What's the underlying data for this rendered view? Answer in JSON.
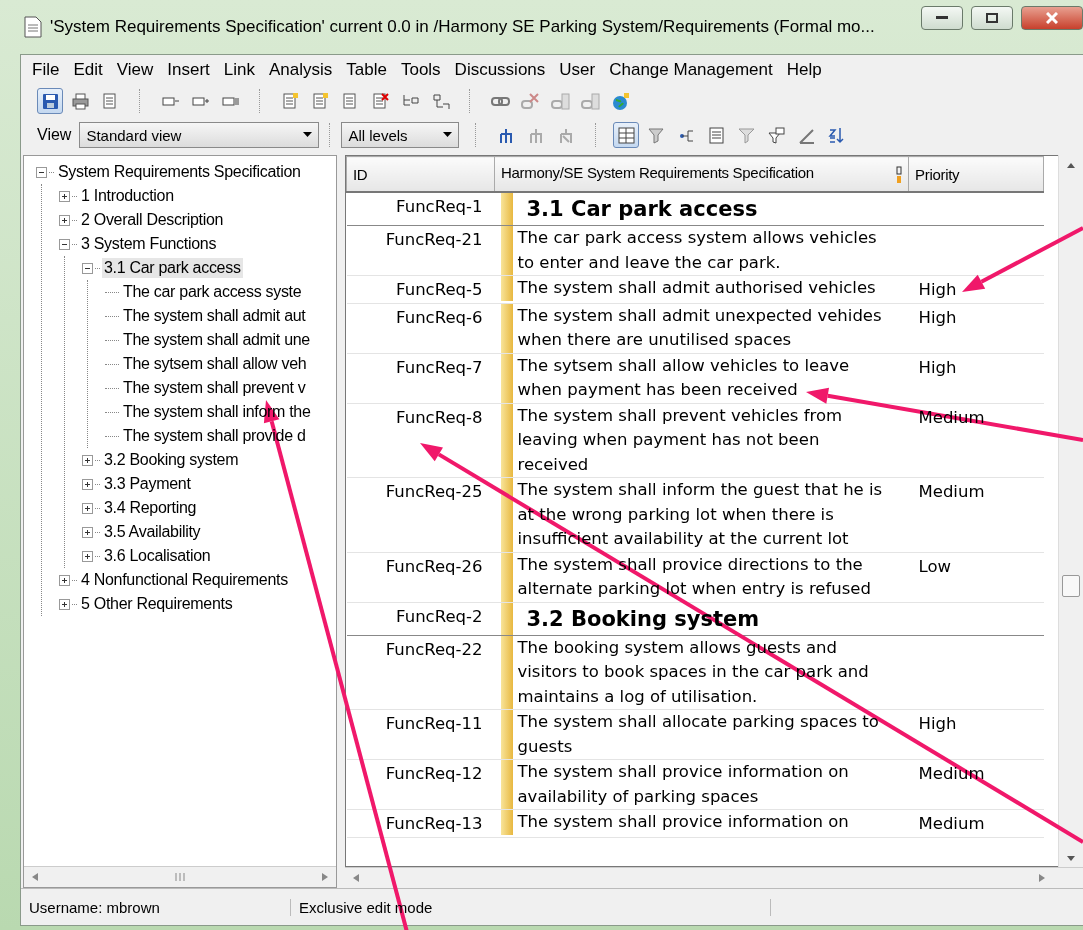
{
  "window": {
    "title": "'System Requirements Specification' current 0.0 in /Harmony SE   Parking System/Requirements (Formal mo..."
  },
  "menu": [
    "File",
    "Edit",
    "View",
    "Insert",
    "Link",
    "Analysis",
    "Table",
    "Tools",
    "Discussions",
    "User",
    "Change Management",
    "Help"
  ],
  "toolbar_1": [
    [
      {
        "selected": true
      },
      {
        "selected": false
      },
      {
        "selected": false
      }
    ],
    [
      {
        "selected": false
      },
      {
        "selected": false
      },
      {
        "selected": false
      }
    ],
    [
      {
        "selected": false
      },
      {
        "selected": false
      },
      {
        "selected": false
      },
      {
        "selected": false
      },
      {
        "selected": false
      },
      {
        "selected": false
      }
    ],
    [
      {
        "selected": false
      },
      {
        "selected": false
      },
      {
        "selected": false
      },
      {
        "selected": false
      },
      {
        "selected": false
      }
    ]
  ],
  "toolbar_2": {
    "view_label": "View",
    "view_select": "Standard view",
    "level_select": "All levels",
    "groups": [
      [
        {
          "selected": false
        },
        {
          "selected": false
        },
        {
          "selected": false
        }
      ],
      [
        {
          "selected": true
        },
        {
          "selected": false
        },
        {
          "selected": false
        },
        {
          "selected": false
        },
        {
          "selected": false
        },
        {
          "selected": false
        },
        {
          "selected": false
        },
        {
          "selected": false
        }
      ]
    ]
  },
  "tree": {
    "label": "System Requirements Specification",
    "expanded": true,
    "selected": false,
    "children": [
      {
        "label": "1 Introduction",
        "expanded": false,
        "selected": false
      },
      {
        "label": "2 Overall Description",
        "expanded": false,
        "selected": false
      },
      {
        "label": "3 System Functions",
        "expanded": true,
        "selected": false,
        "children": [
          {
            "label": "3.1 Car park access",
            "expanded": true,
            "selected": true,
            "children": [
              {
                "label": "The car park access syste",
                "selected": false
              },
              {
                "label": "The system shall admit aut",
                "selected": false
              },
              {
                "label": "The system shall admit une",
                "selected": false
              },
              {
                "label": "The sytsem shall allow veh",
                "selected": false
              },
              {
                "label": "The system shall prevent v",
                "selected": false
              },
              {
                "label": "The system shall inform the",
                "selected": false
              },
              {
                "label": "The system shall provide d",
                "selected": false
              }
            ]
          },
          {
            "label": "3.2 Booking system",
            "expanded": false,
            "selected": false
          },
          {
            "label": "3.3 Payment",
            "expanded": false,
            "selected": false
          },
          {
            "label": "3.4 Reporting",
            "expanded": false,
            "selected": false
          },
          {
            "label": "3.5 Availability",
            "expanded": false,
            "selected": false
          },
          {
            "label": "3.6 Localisation",
            "expanded": false,
            "selected": false
          }
        ]
      },
      {
        "label": "4 Nonfunctional Requirements",
        "expanded": false,
        "selected": false
      },
      {
        "label": "5 Other Requirements",
        "expanded": false,
        "selected": false
      }
    ]
  },
  "table": {
    "columns": [
      "ID",
      "Harmony/SE System Requirements Specification",
      "Priority"
    ],
    "rows": [
      {
        "kind": "heading",
        "id": "FuncReq-1",
        "text": "3.1 Car park access"
      },
      {
        "kind": "text",
        "id": "FuncReq-21",
        "text": "The car park access system allows vehicles to enter and leave the car park."
      },
      {
        "kind": "text",
        "id": "FuncReq-5",
        "text": "The system shall admit authorised vehicles",
        "priority": "High"
      },
      {
        "kind": "text",
        "id": "FuncReq-6",
        "text": "The system shall admit unexpected vehides when there are unutilised spaces",
        "priority": "High"
      },
      {
        "kind": "text",
        "id": "FuncReq-7",
        "text": "The sytsem shall allow vehicles to leave when payment has been received",
        "priority": "High"
      },
      {
        "kind": "text",
        "id": "FuncReq-8",
        "text": "The system shall prevent vehicles from leaving when payment has not been received",
        "priority": "Medium"
      },
      {
        "kind": "text",
        "id": "FuncReq-25",
        "text": "The system shall inform the guest that he is at the wrong parking lot when there is insufficient availability at the current lot",
        "priority": "Medium"
      },
      {
        "kind": "text",
        "id": "FuncReq-26",
        "text": "The system shall provice directions to the alternate parking lot when entry is refused",
        "priority": "Low"
      },
      {
        "kind": "heading",
        "id": "FuncReq-2",
        "text": "3.2 Booking system"
      },
      {
        "kind": "text",
        "id": "FuncReq-22",
        "text": "The booking system allows guests and visitors to book spaces in the car park and maintains a log of utilisation."
      },
      {
        "kind": "text",
        "id": "FuncReq-11",
        "text": "The system shall allocate parking spaces to guests",
        "priority": "High"
      },
      {
        "kind": "text",
        "id": "FuncReq-12",
        "text": "The system shall provice information on availability of parking spaces",
        "priority": "Medium"
      },
      {
        "kind": "text",
        "id": "FuncReq-13",
        "text": "The system shall provice information on",
        "priority": "Medium"
      }
    ]
  },
  "status_bar": [
    "Username: mbrown",
    "Exclusive edit mode"
  ]
}
